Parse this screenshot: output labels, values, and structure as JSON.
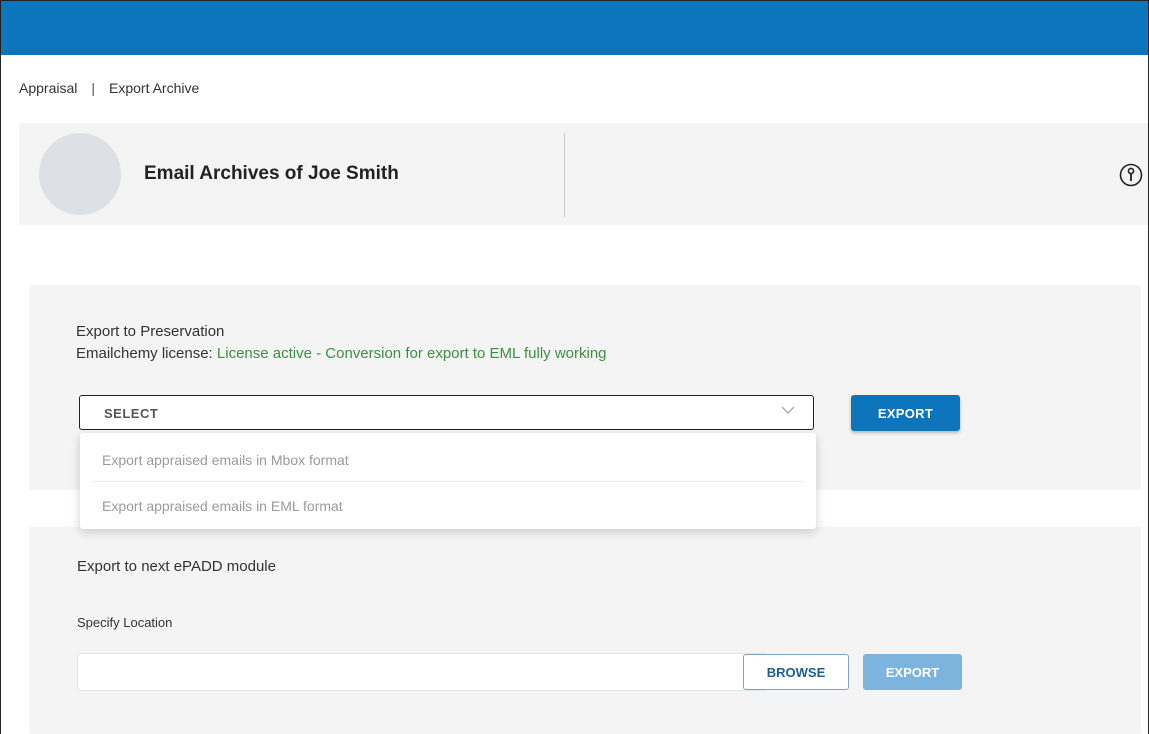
{
  "breadcrumb": {
    "item1": "Appraisal",
    "separator": "|",
    "item2": "Export Archive"
  },
  "header": {
    "archive_title": "Email Archives of Joe Smith",
    "help_icon": "help-circle-icon"
  },
  "export_preservation": {
    "title": "Export to Preservation",
    "license_label": "Emailchemy license:",
    "license_status": "License active - Conversion for export to EML fully working",
    "select": {
      "selected_value": "SELECT",
      "options": [
        "Export appraised emails in Mbox format",
        "Export appraised emails in EML format"
      ]
    },
    "export_button": "EXPORT"
  },
  "export_next_module": {
    "title": "Export to next ePADD module",
    "location_label": "Specify Location",
    "location_value": "",
    "browse_button": "BROWSE",
    "export_button": "EXPORT"
  },
  "colors": {
    "brand_blue": "#0d75bc",
    "license_green": "#3e8e41",
    "disabled_blue": "#7cb4dd"
  }
}
